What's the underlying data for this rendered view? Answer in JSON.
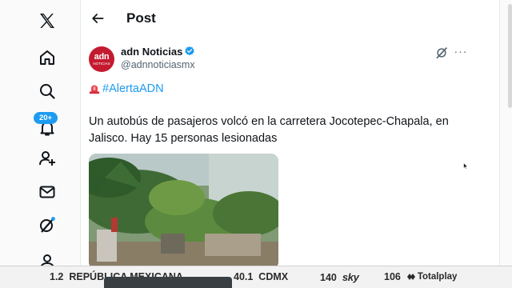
{
  "nav": {
    "items": [
      "x-logo",
      "home",
      "explore",
      "notifications",
      "create",
      "messages",
      "grok",
      "profile"
    ],
    "notifications_badge": "20+"
  },
  "header": {
    "title": "Post"
  },
  "post": {
    "author_name": "adn Noticias",
    "author_handle": "@adnnoticiasmx",
    "avatar_text": "adn",
    "avatar_subtext": "NOTICIAS",
    "hashtag": "#AlertaADN",
    "text": "Un autobús de pasajeros volcó en la carretera Jocotepec-Chapala, en Jalisco. Hay 15 personas lesionadas",
    "more_label": "···"
  },
  "ticker": {
    "items": [
      {
        "num": "1.2",
        "label": "REPÚBLICA MEXICANA"
      },
      {
        "num": "40.1",
        "label": "CDMX"
      },
      {
        "num": "140",
        "label": "sky"
      },
      {
        "num": "106",
        "label": "Totalplay"
      }
    ]
  },
  "colors": {
    "accent": "#1d9bf0",
    "brand_red": "#c41a30",
    "text": "#0f1419",
    "muted": "#536471"
  }
}
